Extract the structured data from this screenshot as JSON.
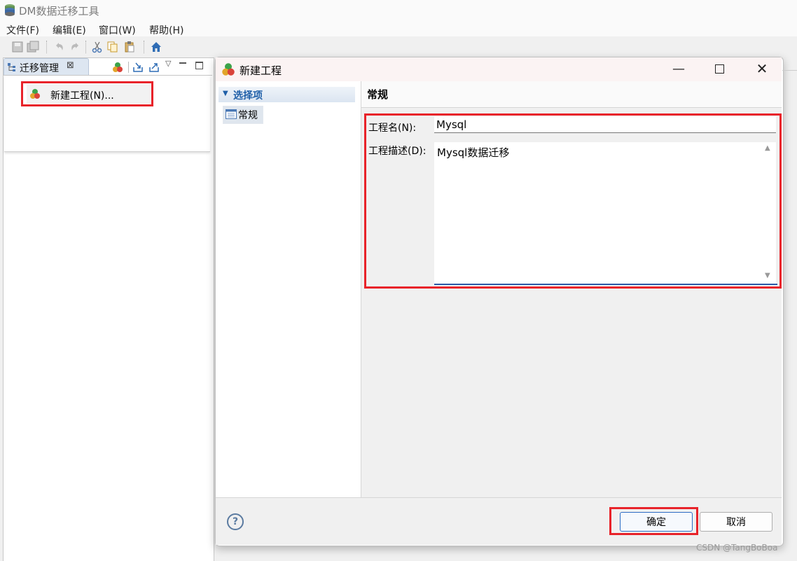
{
  "app": {
    "title": "DM数据迁移工具"
  },
  "menubar": {
    "items": [
      "文件(F)",
      "编辑(E)",
      "窗口(W)",
      "帮助(H)"
    ]
  },
  "left_view": {
    "tab_label": "迁移管理",
    "context_menu_item": "新建工程(N)..."
  },
  "dialog": {
    "title": "新建工程",
    "nav_header": "选择项",
    "nav_item": "常规",
    "content_title": "常规",
    "name_label": "工程名(N):",
    "name_value": "Mysql",
    "desc_label": "工程描述(D):",
    "desc_value": "Mysql数据迁移",
    "ok_label": "确定",
    "cancel_label": "取消",
    "help_symbol": "?"
  },
  "watermark": "CSDN @TangBoBoa",
  "colors": {
    "highlight": "#e8232a",
    "accent": "#1f5fa8"
  }
}
